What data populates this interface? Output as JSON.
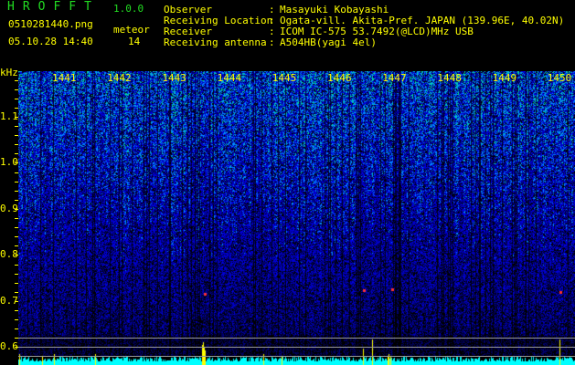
{
  "header": {
    "app_name": "HROFFT",
    "version": "1.0.0",
    "filename": "0510281440.png",
    "datetime": "05.10.28 14:40",
    "meteor_label": "meteor",
    "meteor_count": "14",
    "info": [
      {
        "label": "Observer",
        "value": "Masayuki Kobayashi"
      },
      {
        "label": "Receiving Location",
        "value": "Ogata-vill. Akita-Pref. JAPAN (139.96E, 40.02N)"
      },
      {
        "label": "Receiver",
        "value": "ICOM IC-575 53.7492(@LCD)MHz USB"
      },
      {
        "label": "Receiving antenna",
        "value": "A504HB(yagi 4el)"
      }
    ]
  },
  "axis": {
    "unit": "kHz",
    "y_labels": [
      "1.1",
      "1.0",
      "0.9",
      "0.8",
      "0.7",
      "0.6"
    ],
    "minute_labels": [
      "1441",
      "1442",
      "1443",
      "1444",
      "1445",
      "1446",
      "1447",
      "1448",
      "1449",
      "1450"
    ]
  },
  "colors": {
    "text": "#ffff00",
    "title": "#22dd22",
    "level": "#00ffff"
  }
}
